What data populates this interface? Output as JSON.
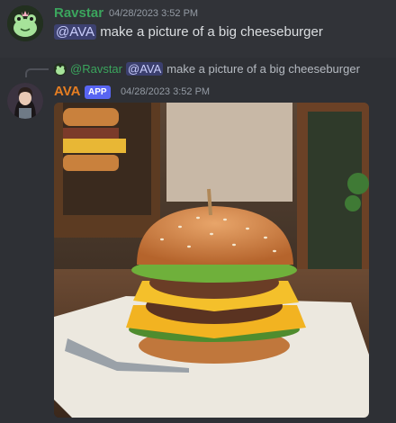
{
  "messages": [
    {
      "author": "Ravstar",
      "author_color": "#3ba55d",
      "timestamp": "04/28/2023 3:52 PM",
      "mention": "@AVA",
      "text": "make a picture of a big cheeseburger"
    },
    {
      "author": "AVA",
      "author_color": "#e67e22",
      "badge": "APP",
      "timestamp": "04/28/2023 3:52 PM",
      "reply": {
        "author": "@Ravstar",
        "mention": "@AVA",
        "text": "make a picture of a big cheeseburger"
      },
      "attachment": "generated-image"
    }
  ],
  "colors": {
    "background": "#313338",
    "mention_bg": "#3c4270",
    "app_badge": "#5865f2"
  },
  "icons": [
    "frog-avatar-icon",
    "bot-avatar-icon",
    "reply-avatar-icon"
  ]
}
